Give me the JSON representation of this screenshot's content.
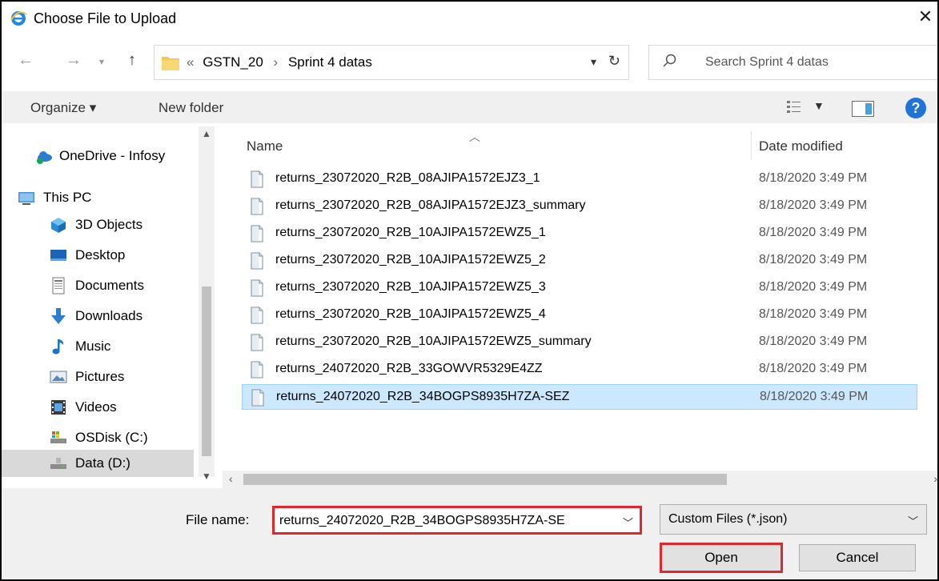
{
  "window": {
    "title": "Choose File to Upload",
    "close_glyph": "✕"
  },
  "address_bar": {
    "overflow_glyph": "«",
    "breadcrumbs": [
      "GSTN_20",
      "Sprint 4 datas"
    ],
    "separator": "›",
    "refresh_glyph": "↻"
  },
  "search": {
    "placeholder": "Search Sprint 4 datas"
  },
  "toolbar": {
    "organize_label": "Organize ▾",
    "new_folder_label": "New folder",
    "help_label": "?"
  },
  "sidebar": {
    "items": [
      {
        "label": "OneDrive - Infosy",
        "icon": "cloud-icon"
      },
      {
        "label": "This PC",
        "icon": "computer-icon"
      },
      {
        "label": "3D Objects",
        "icon": "cube-icon"
      },
      {
        "label": "Desktop",
        "icon": "desktop-icon"
      },
      {
        "label": "Documents",
        "icon": "document-icon"
      },
      {
        "label": "Downloads",
        "icon": "download-icon"
      },
      {
        "label": "Music",
        "icon": "music-icon"
      },
      {
        "label": "Pictures",
        "icon": "pictures-icon"
      },
      {
        "label": "Videos",
        "icon": "videos-icon"
      },
      {
        "label": "OSDisk (C:)",
        "icon": "drive-icon"
      },
      {
        "label": "Data (D:)",
        "icon": "drive-icon"
      }
    ],
    "selected": "Data (D:)"
  },
  "file_list": {
    "columns": [
      "Name",
      "Date modified"
    ],
    "rows": [
      {
        "name": "returns_23072020_R2B_08AJIPA1572EJZ3_1",
        "date": "8/18/2020 3:49 PM"
      },
      {
        "name": "returns_23072020_R2B_08AJIPA1572EJZ3_summary",
        "date": "8/18/2020 3:49 PM"
      },
      {
        "name": "returns_23072020_R2B_10AJIPA1572EWZ5_1",
        "date": "8/18/2020 3:49 PM"
      },
      {
        "name": "returns_23072020_R2B_10AJIPA1572EWZ5_2",
        "date": "8/18/2020 3:49 PM"
      },
      {
        "name": "returns_23072020_R2B_10AJIPA1572EWZ5_3",
        "date": "8/18/2020 3:49 PM"
      },
      {
        "name": "returns_23072020_R2B_10AJIPA1572EWZ5_4",
        "date": "8/18/2020 3:49 PM"
      },
      {
        "name": "returns_23072020_R2B_10AJIPA1572EWZ5_summary",
        "date": "8/18/2020 3:49 PM"
      },
      {
        "name": "returns_24072020_R2B_33GOWVR5329E4ZZ",
        "date": "8/18/2020 3:49 PM"
      },
      {
        "name": "returns_24072020_R2B_34BOGPS8935H7ZA-SEZ",
        "date": "8/18/2020 3:49 PM"
      }
    ],
    "selected_index": 8
  },
  "footer": {
    "file_name_label": "File name:",
    "file_name_value": "returns_24072020_R2B_34BOGPS8935H7ZA-SE",
    "file_type_value": "Custom Files (*.json)",
    "open_label": "Open",
    "cancel_label": "Cancel"
  },
  "colors": {
    "highlight_border": "#e0262e",
    "selection_bg": "#cce8ff",
    "help_blue": "#1f74d9"
  }
}
